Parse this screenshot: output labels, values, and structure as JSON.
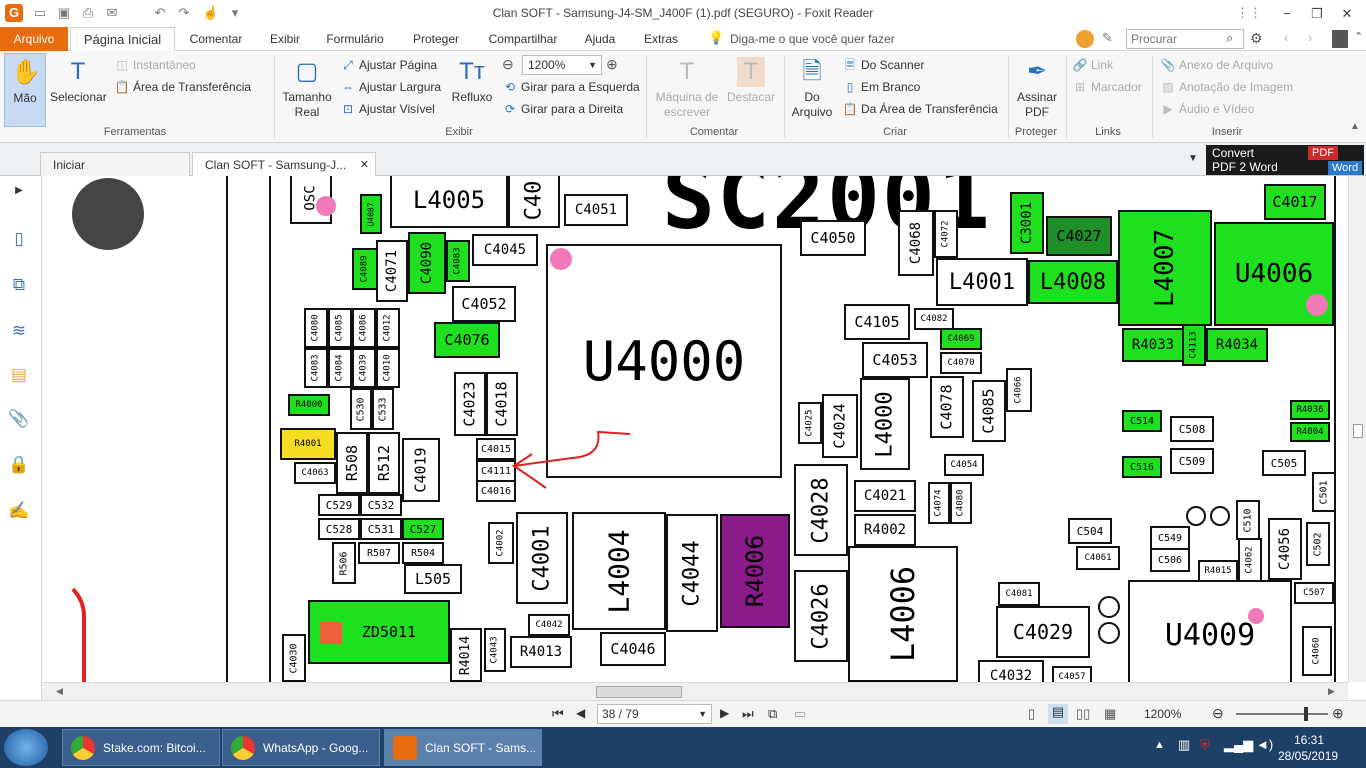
{
  "window": {
    "title": "Clan SOFT - Samsung-J4-SM_J400F (1).pdf (SEGURO) - Foxit Reader",
    "minimize": "−",
    "restore": "❐",
    "close": "✕"
  },
  "menu": {
    "file": "Arquivo",
    "items": [
      "Página Inicial",
      "Comentar",
      "Exibir",
      "Formulário",
      "Proteger",
      "Compartilhar",
      "Ajuda",
      "Extras"
    ],
    "tell_me": "Diga-me o que você quer fazer",
    "search_placeholder": "Procurar"
  },
  "ribbon": {
    "ferramentas": {
      "label": "Ferramentas",
      "hand": "Mão",
      "select": "Selecionar",
      "snapshot": "Instantâneo",
      "clipboard": "Área de Transferência"
    },
    "exibir": {
      "label": "Exibir",
      "actual_size_1": "Tamanho",
      "actual_size_2": "Real",
      "fit_page": "Ajustar Página",
      "fit_width": "Ajustar Largura",
      "fit_visible": "Ajustar Visível",
      "reflow": "Refluxo",
      "zoom": "1200%",
      "rotate_left": "Girar para a Esquerda",
      "rotate_right": "Girar para a Direita"
    },
    "comentar": {
      "label": "Comentar",
      "typewriter_1": "Máquina de",
      "typewriter_2": "escrever",
      "highlight": "Destacar"
    },
    "criar": {
      "label": "Criar",
      "from_file_1": "Do",
      "from_file_2": "Arquivo",
      "from_scanner": "Do Scanner",
      "blank": "Em Branco",
      "from_clipboard": "Da Área de Transferência"
    },
    "proteger": {
      "label": "Proteger",
      "sign_1": "Assinar",
      "sign_2": "PDF"
    },
    "links": {
      "label": "Links",
      "link": "Link",
      "bookmark": "Marcador"
    },
    "inserir": {
      "label": "Inserir",
      "attachment": "Anexo de Arquivo",
      "image": "Anotação de Imagem",
      "audio_video": "Áudio e Vídeo"
    }
  },
  "tabs": {
    "home": "Iniciar",
    "doc": "Clan SOFT - Samsung-J...",
    "close": "✕"
  },
  "ad": {
    "line1": "Convert",
    "line2": "PDF 2 Word",
    "pdf": "PDF",
    "word": "Word"
  },
  "status": {
    "page": "38 / 79",
    "zoom": "1200%"
  },
  "taskbar": {
    "items": [
      "Stake.com: Bitcoi...",
      "WhatsApp - Goog...",
      "Clan SOFT - Sams..."
    ],
    "time": "16:31",
    "date": "28/05/2019"
  },
  "schematic": {
    "big_label": "SC2001",
    "components": [
      "OSC",
      "L4005",
      "C40",
      "C4051",
      "C4045",
      "C4071",
      "C4090",
      "C4083",
      "C4089",
      "U4087",
      "C4052",
      "C4076",
      "U4000",
      "C4023",
      "C4018",
      "C4015",
      "C4111",
      "C4016",
      "C4080",
      "C4085",
      "C4086",
      "C4012",
      "C4083",
      "C4084",
      "C4039",
      "C4010",
      "R4000",
      "C530",
      "C533",
      "R4001",
      "C4063",
      "R508",
      "R512",
      "C4019",
      "C529",
      "C532",
      "C528",
      "C531",
      "C527",
      "R506",
      "R507",
      "R504",
      "L505",
      "ZD5011",
      "C4030",
      "R4014",
      "C4043",
      "R4013",
      "C4042",
      "C4046",
      "C4002",
      "C4001",
      "L4004",
      "C4044",
      "R4006",
      "C4028",
      "C4026",
      "L4006",
      "C4021",
      "R4002",
      "C4074",
      "C4080",
      "C4054",
      "C4025",
      "C4024",
      "L4000",
      "C4078",
      "C4085",
      "C4066",
      "C4105",
      "C4082",
      "C4053",
      "C4069",
      "C4070",
      "C4050",
      "C4068",
      "C4072",
      "L4001",
      "C3001",
      "C4027",
      "L4008",
      "L4007",
      "U4006",
      "C4017",
      "R4033",
      "C4113",
      "R4034",
      "R4036",
      "R4004",
      "C514",
      "C508",
      "C516",
      "C509",
      "C505",
      "C501",
      "C510",
      "C504",
      "C4061",
      "C549",
      "C506",
      "R4015",
      "C4062",
      "C4056",
      "C502",
      "C4081",
      "C4029",
      "C4032",
      "C4057",
      "U4009",
      "C507",
      "C4060"
    ]
  },
  "colors": {
    "accent": "#e86b0e",
    "green": "#1ee01e",
    "purple": "#8b1a8b",
    "yellow": "#f4dd22",
    "pink": "#f07ab8",
    "taskbar": "#1e3f66"
  }
}
